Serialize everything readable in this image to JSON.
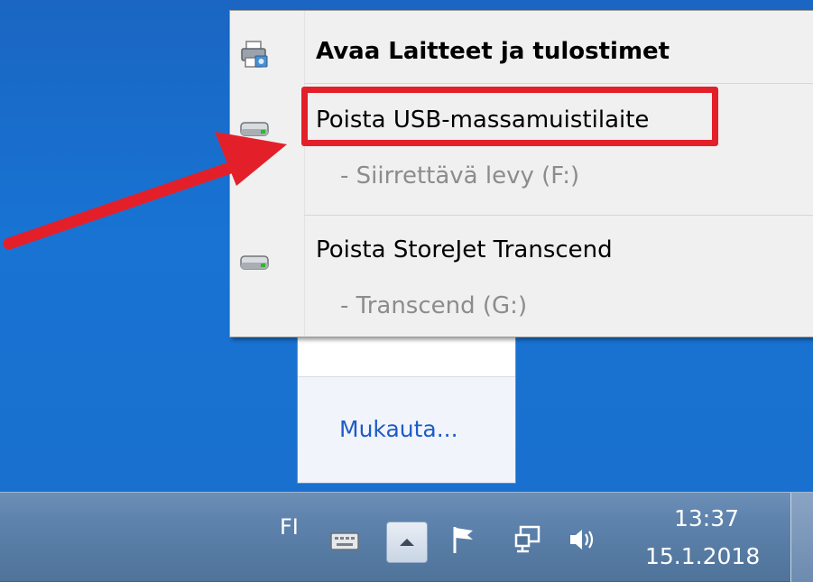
{
  "menu": {
    "open_devices": "Avaa Laitteet ja tulostimet",
    "eject_usb": "Poista USB-massamuistilaite",
    "usb_drive": "- Siirrettävä levy (F:)",
    "eject_storejet": "Poista StoreJet Transcend",
    "storejet_drive": "- Transcend (G:)"
  },
  "flyout": {
    "customize": "Mukauta..."
  },
  "taskbar": {
    "language": "FI",
    "time": "13:37",
    "date": "15.1.2018"
  },
  "colors": {
    "highlight": "#e3202a",
    "link": "#1e5bc6",
    "desktop": "#1873d3"
  },
  "icons": {
    "printer": "printer-icon",
    "drive": "drive-icon",
    "keyboard": "keyboard-icon",
    "up_arrow": "chevron-up-icon",
    "flag": "action-center-flag-icon",
    "network": "network-icon",
    "volume": "volume-icon"
  }
}
